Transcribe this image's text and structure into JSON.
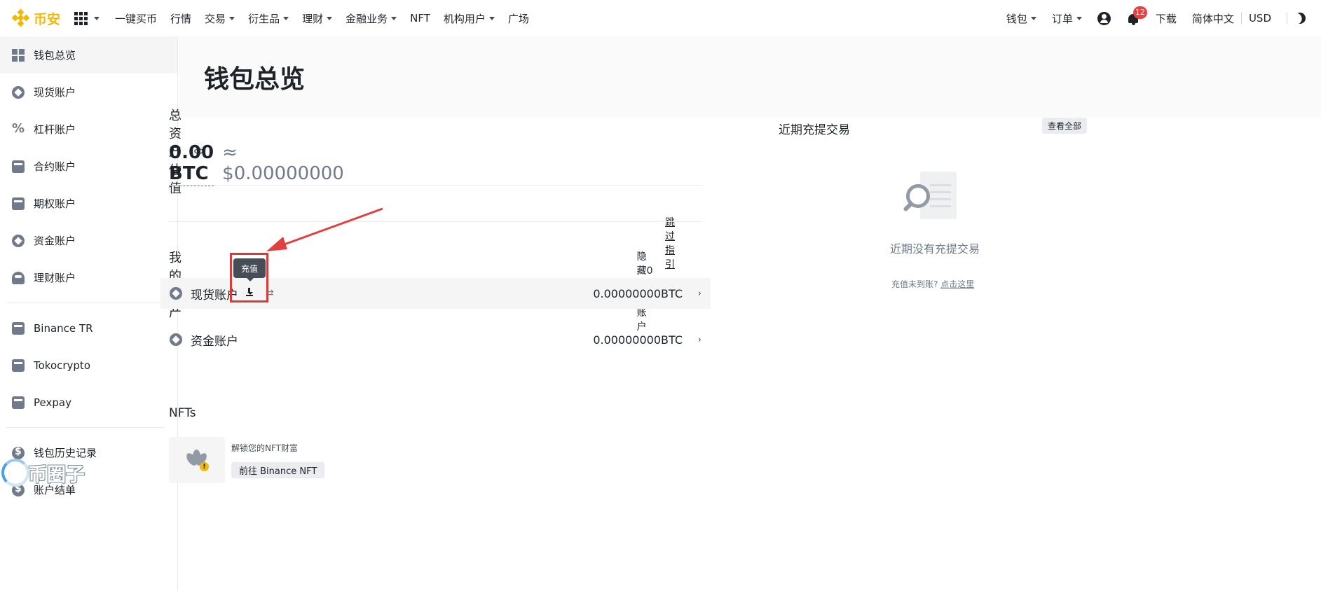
{
  "brand": {
    "name": "币安",
    "color": "#f0b90b"
  },
  "nav": {
    "items": [
      {
        "label": "一键买币",
        "caret": false
      },
      {
        "label": "行情",
        "caret": false
      },
      {
        "label": "交易",
        "caret": true
      },
      {
        "label": "衍生品",
        "caret": true
      },
      {
        "label": "理财",
        "caret": true
      },
      {
        "label": "金融业务",
        "caret": true
      },
      {
        "label": "NFT",
        "caret": false
      },
      {
        "label": "机构用户",
        "caret": true
      },
      {
        "label": "广场",
        "caret": false
      }
    ],
    "right": {
      "wallet": "钱包",
      "orders": "订单",
      "notification_count": "12",
      "download": "下载",
      "language": "简体中文",
      "currency": "USD"
    }
  },
  "sidebar": {
    "items": [
      {
        "label": "钱包总览",
        "icon": "grid-icon",
        "active": true
      },
      {
        "label": "现货账户",
        "icon": "spot-icon"
      },
      {
        "label": "杠杆账户",
        "icon": "percent-icon"
      },
      {
        "label": "合约账户",
        "icon": "futures-icon"
      },
      {
        "label": "期权账户",
        "icon": "options-icon"
      },
      {
        "label": "资金账户",
        "icon": "funding-icon"
      },
      {
        "label": "理财账户",
        "icon": "earn-icon"
      }
    ],
    "partners": [
      {
        "label": "Binance TR",
        "icon": "wallet-icon"
      },
      {
        "label": "Tokocrypto",
        "icon": "wallet-icon"
      },
      {
        "label": "Pexpay",
        "icon": "wallet-icon"
      }
    ],
    "records": [
      {
        "label": "钱包历史记录",
        "icon": "history-icon"
      },
      {
        "label": "账户结单",
        "icon": "statement-icon"
      }
    ]
  },
  "main": {
    "title": "钱包总览",
    "total_label": "总资产估值",
    "total_btc": "0.00 BTC",
    "total_usd": "≈ $0.00000000",
    "skip_guide": "跳过指引",
    "my_assets": "我的资产",
    "hide_zero": "隐藏0资产账户",
    "deposit_tooltip": "充值",
    "assets": [
      {
        "label": "现货账户",
        "amount": "0.00000000BTC",
        "highlight": true
      },
      {
        "label": "资金账户",
        "amount": "0.00000000BTC",
        "highlight": false
      }
    ],
    "nfts": {
      "title": "NFTs",
      "unlock": "解锁您的NFT财富",
      "button": "前往 Binance NFT"
    }
  },
  "recent": {
    "title": "近期充提交易",
    "view_all": "查看全部",
    "empty": "近期没有充提交易",
    "not_arrived": "充值未到账?",
    "click_here": "点击这里"
  },
  "watermark": {
    "text": "币圈子"
  },
  "colors": {
    "annotation": "#d93a3a",
    "text": "#1e2329",
    "muted": "#707a8a"
  }
}
